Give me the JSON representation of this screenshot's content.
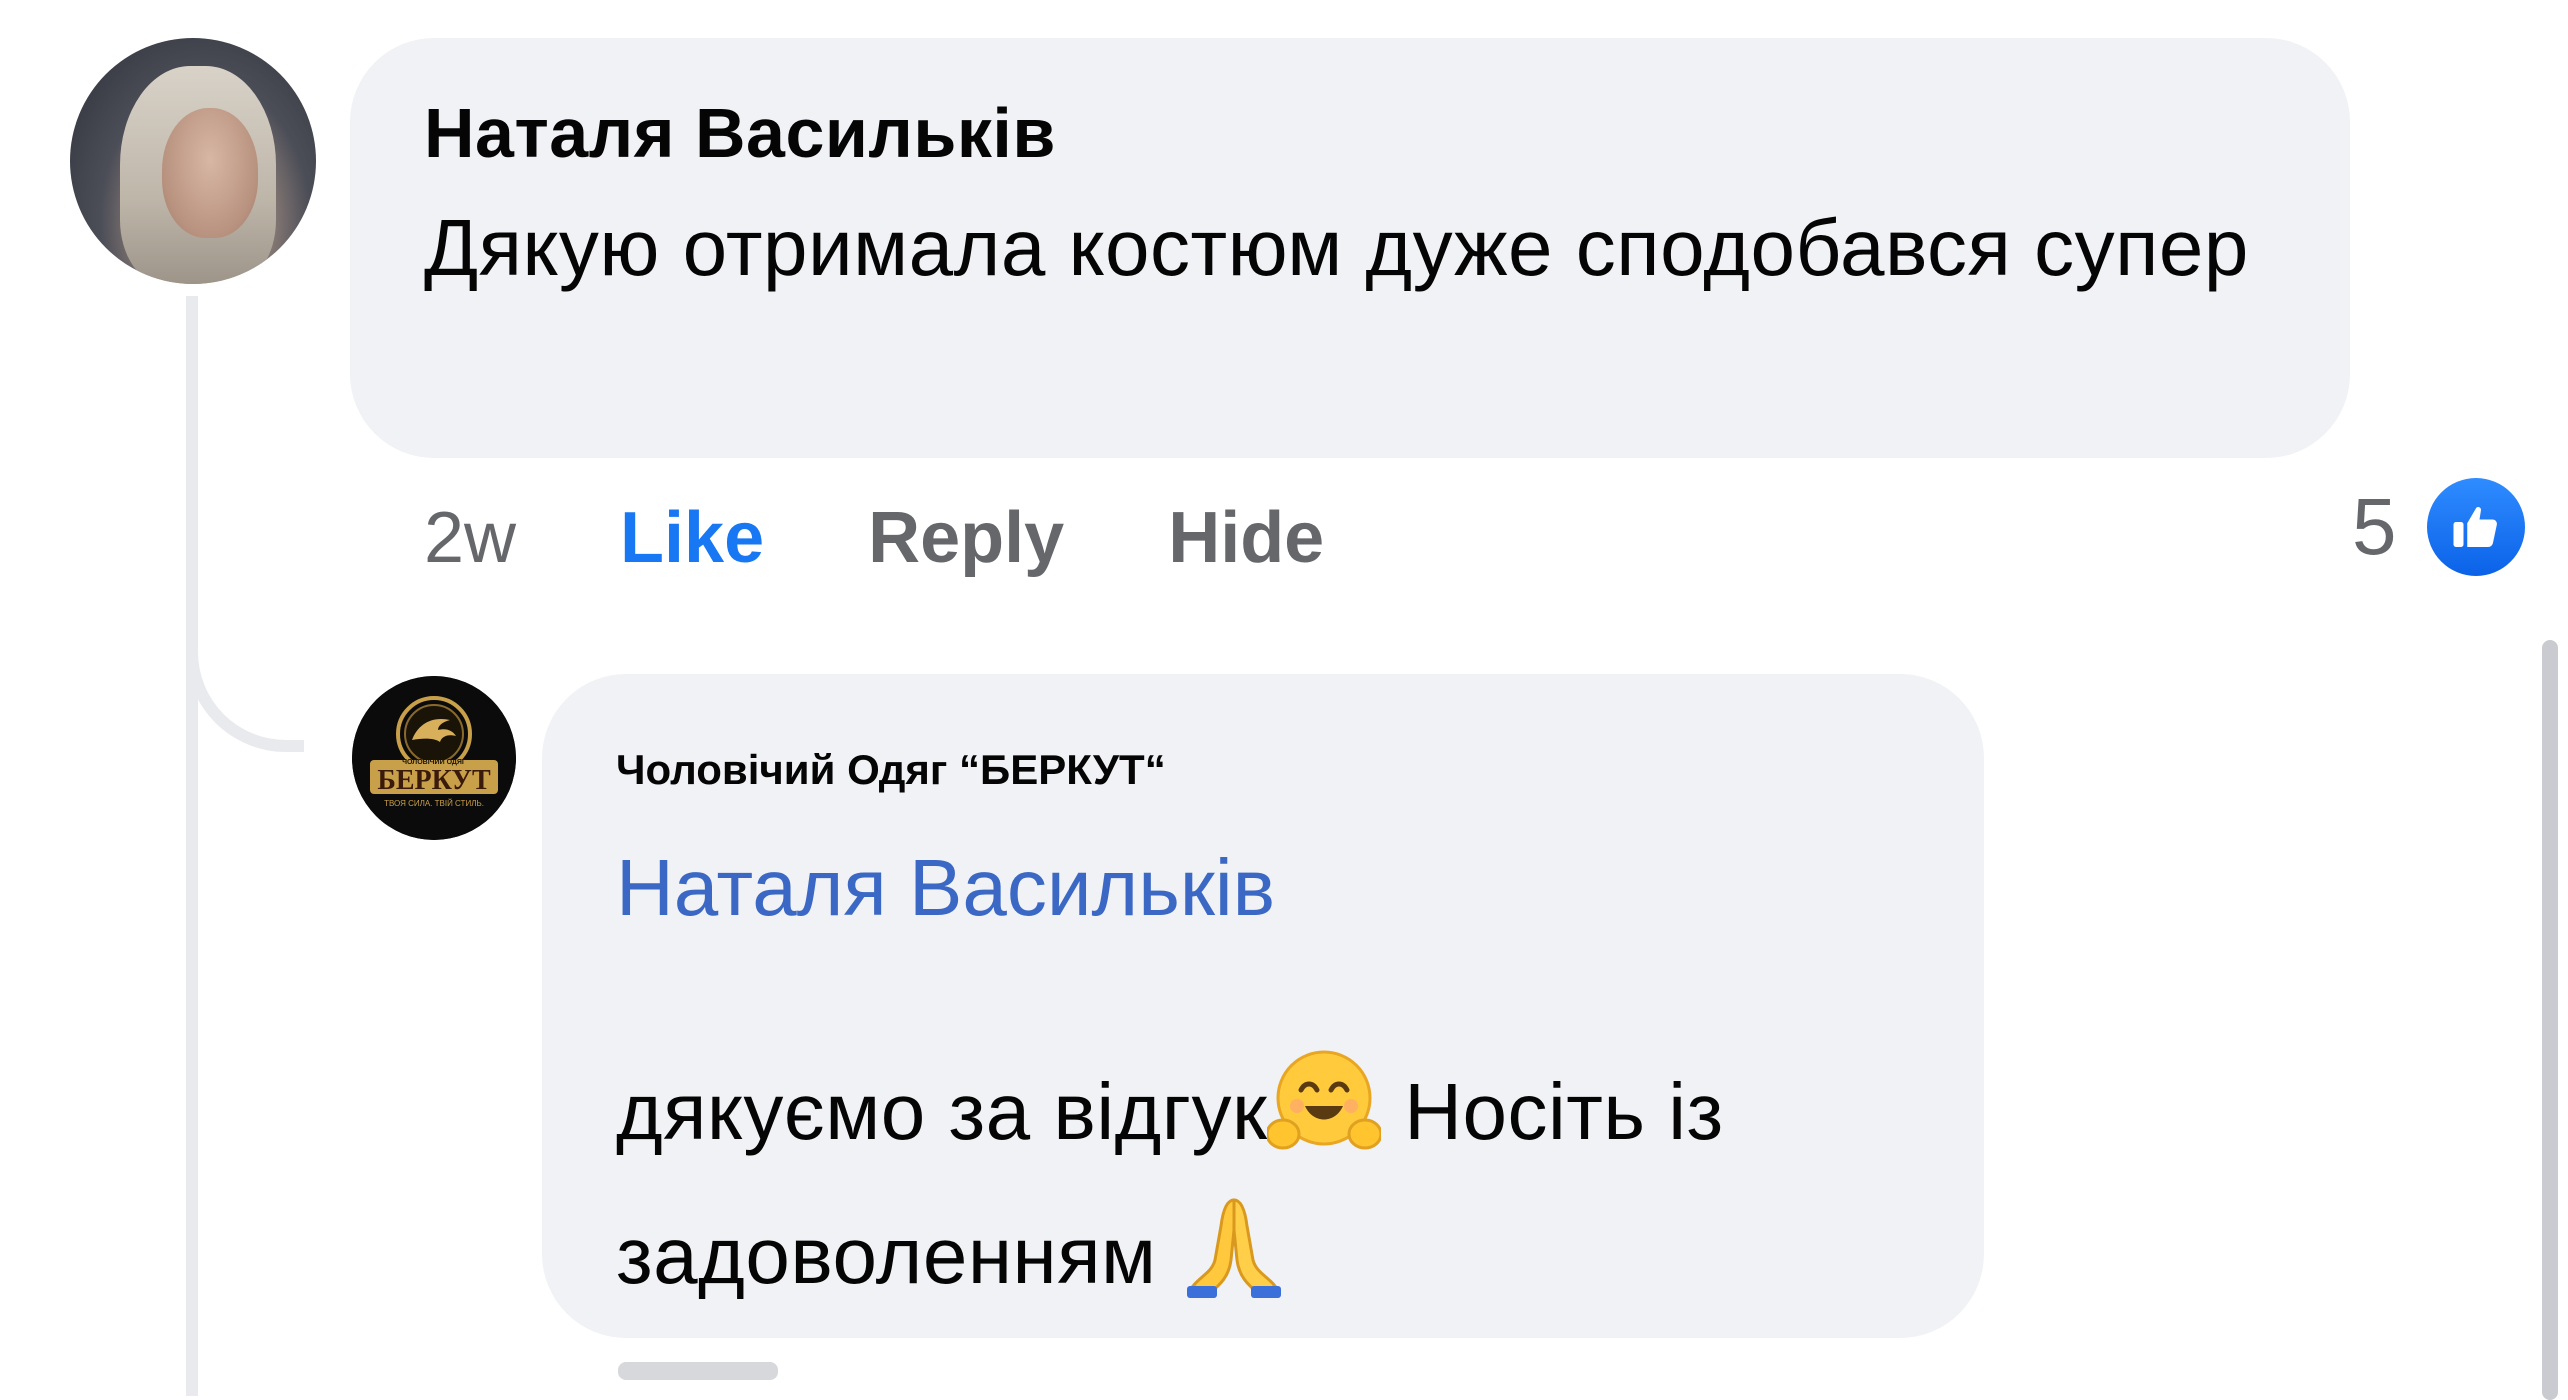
{
  "comment": {
    "author": "Наталя Васильків",
    "text": "Дякую отримала костюм дуже сподобався супер",
    "time": "2w",
    "actions": {
      "like": "Like",
      "reply": "Reply",
      "hide": "Hide"
    },
    "reactions": {
      "count": "5",
      "icon": "thumbs-up-icon",
      "color": "#1877f2"
    }
  },
  "reply": {
    "author": "Чоловічий Одяг “БЕРКУТ“",
    "mention": "Наталя Васильків",
    "text_part1": "дякуємо за відгук",
    "text_part2": " Носіть із задоволенням ",
    "emoji_1": "hugging-face-emoji",
    "emoji_2": "folded-hands-emoji",
    "avatar_logo": {
      "brand": "БЕРКУТ",
      "top_line": "ЧОЛОВІЧИЙ ОДЯГ",
      "tagline": "ТВОЯ СИЛА. ТВІЙ СТИЛЬ."
    }
  },
  "colors": {
    "bubble": "#f0f2f5",
    "link": "#3b68c4",
    "secondary": "#65676b",
    "like_blue": "#1877f2"
  }
}
